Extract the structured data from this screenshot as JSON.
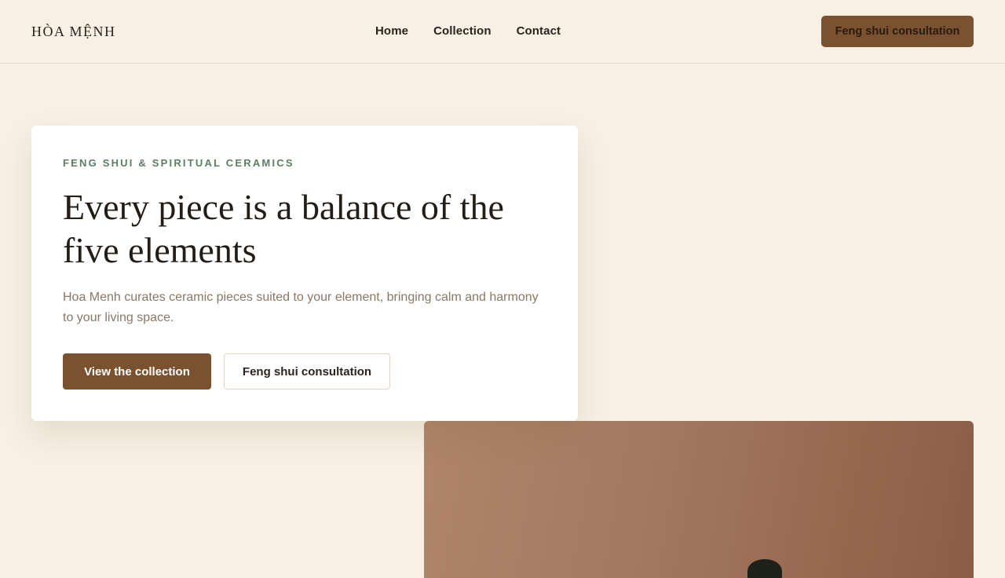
{
  "header": {
    "brand": "HÒA MỆNH",
    "nav": [
      "Home",
      "Collection",
      "Contact"
    ],
    "cta_label": "Feng shui consultation"
  },
  "hero": {
    "eyebrow": "FENG SHUI & SPIRITUAL CERAMICS",
    "headline": "Every piece is a balance of the five elements",
    "lede": "Hoa Menh curates ceramic pieces suited to your element, bringing calm and harmony to your living space.",
    "primary_button": "View the collection",
    "secondary_button": "Feng shui consultation"
  },
  "colors": {
    "background": "#f8f0e5",
    "accent": "#7a5230",
    "eyebrow": "#5b7f64"
  }
}
